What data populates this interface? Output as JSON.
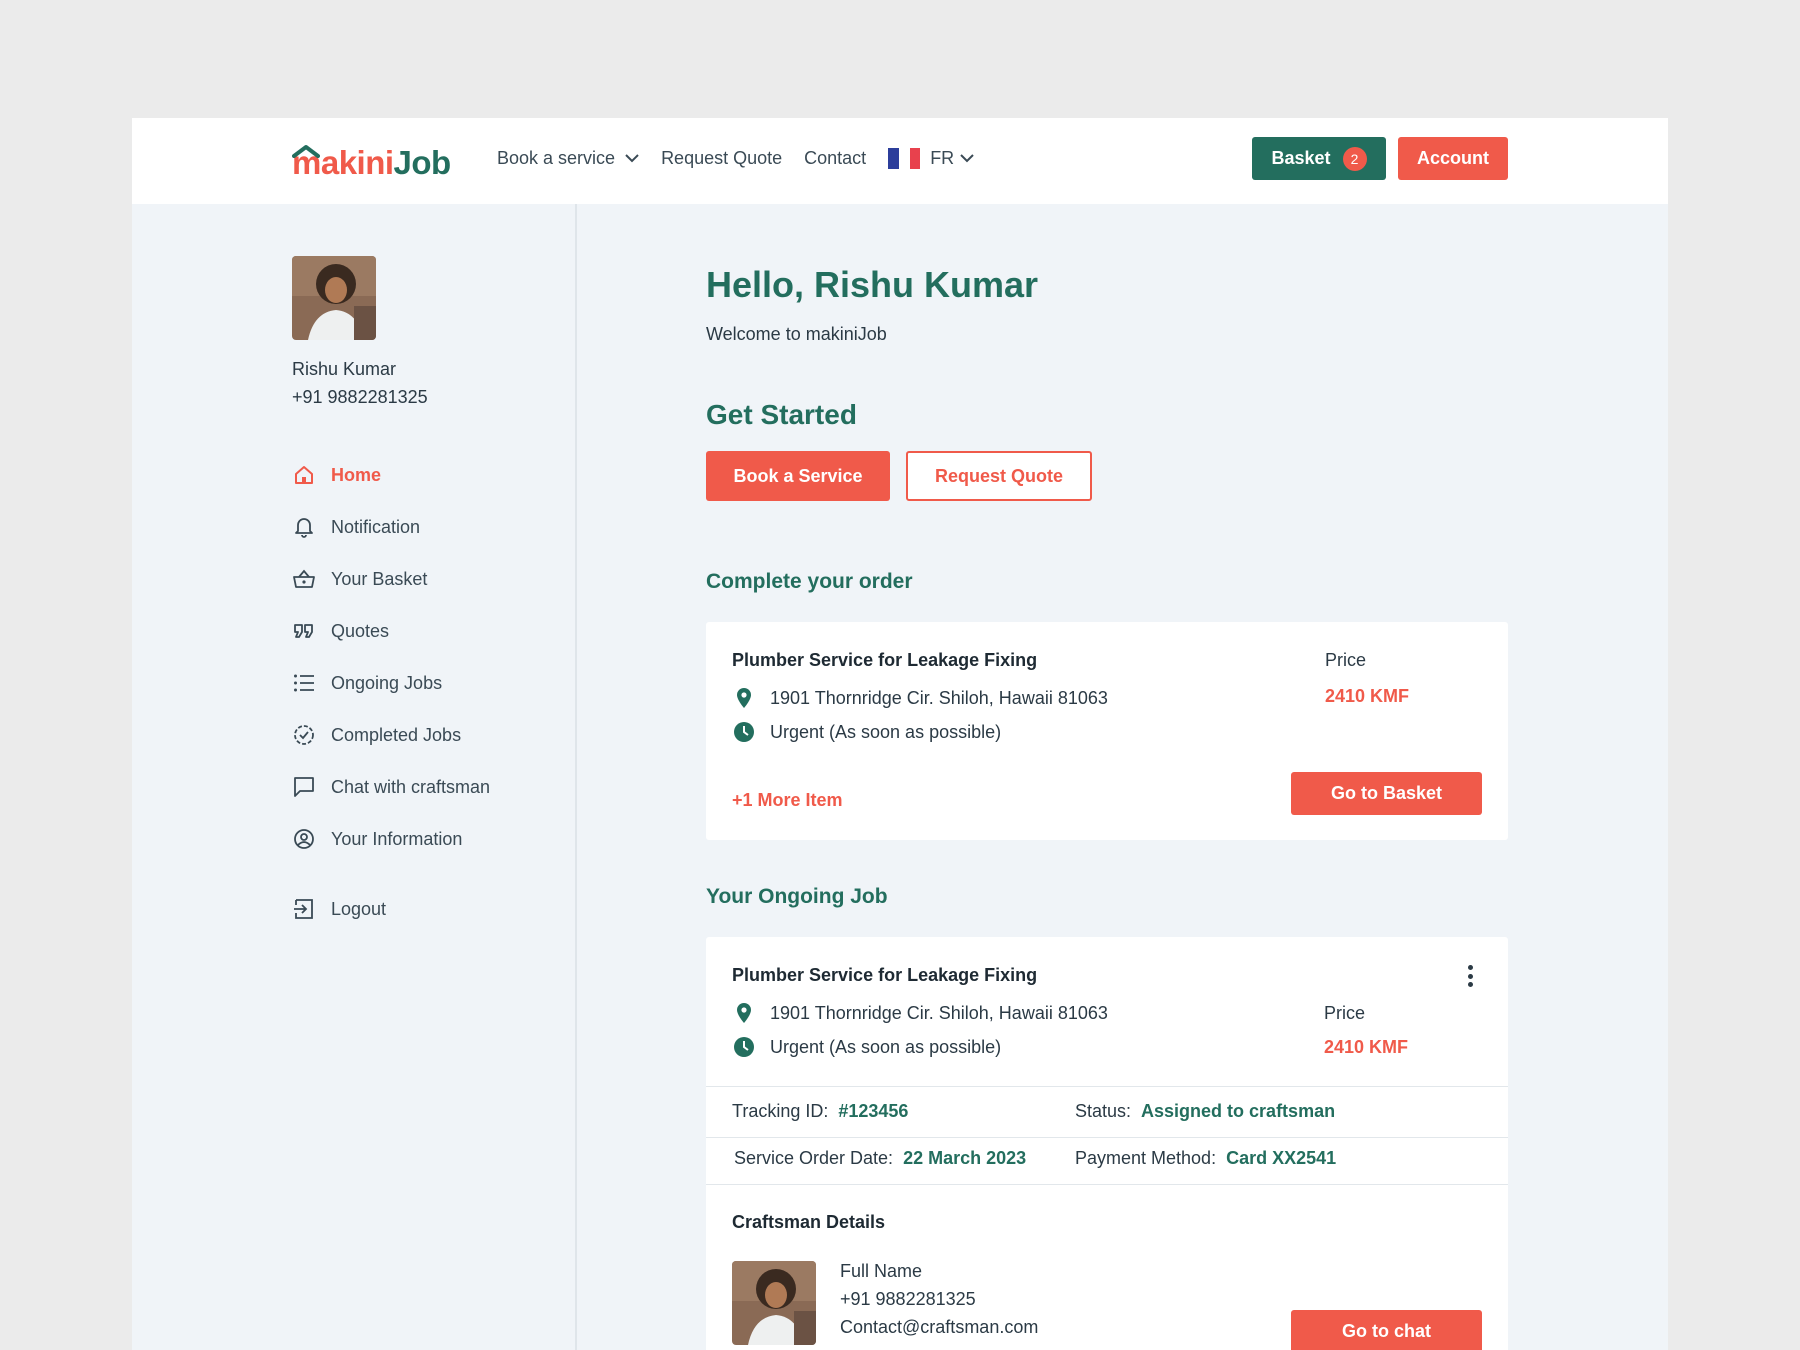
{
  "brand": {
    "logo_part1": "makini",
    "logo_part2": "Job",
    "primary": "#236e5e",
    "accent": "#f05a4a"
  },
  "nav": {
    "book_service": "Book a service",
    "request_quote": "Request Quote",
    "contact": "Contact",
    "language": "FR",
    "basket_label": "Basket",
    "basket_count": "2",
    "account_label": "Account"
  },
  "user": {
    "name": "Rishu Kumar",
    "phone": "+91 9882281325"
  },
  "sidebar": {
    "items": [
      {
        "label": "Home",
        "icon": "home-icon"
      },
      {
        "label": "Notification",
        "icon": "bell-icon"
      },
      {
        "label": "Your Basket",
        "icon": "basket-icon"
      },
      {
        "label": "Quotes",
        "icon": "quote-icon"
      },
      {
        "label": "Ongoing Jobs",
        "icon": "list-icon"
      },
      {
        "label": "Completed Jobs",
        "icon": "check-circle-icon"
      },
      {
        "label": "Chat with craftsman",
        "icon": "chat-icon"
      },
      {
        "label": "Your Information",
        "icon": "user-circle-icon"
      }
    ],
    "logout": "Logout"
  },
  "main": {
    "hello": "Hello, Rishu Kumar",
    "welcome": "Welcome to makiniJob",
    "get_started": "Get Started",
    "book_button": "Book a Service",
    "quote_button": "Request Quote",
    "complete_order_title": "Complete your order",
    "ongoing_title": "Your Ongoing Job"
  },
  "order": {
    "service": "Plumber Service for Leakage Fixing",
    "address": "1901 Thornridge Cir. Shiloh, Hawaii 81063",
    "urgency": "Urgent (As soon as possible)",
    "price_label": "Price",
    "price": "2410 KMF",
    "more": "+1 More Item",
    "button": "Go to Basket"
  },
  "ongoing": {
    "service": "Plumber Service for Leakage Fixing",
    "address": "1901 Thornridge Cir. Shiloh, Hawaii 81063",
    "urgency": "Urgent (As soon as possible)",
    "price_label": "Price",
    "price": "2410 KMF",
    "tracking_label": "Tracking ID:",
    "tracking_value": "#123456",
    "status_label": "Status:",
    "status_value": "Assigned to craftsman",
    "date_label": "Service Order Date:",
    "date_value": "22 March 2023",
    "payment_label": "Payment Method:",
    "payment_value": "Card XX2541",
    "craftsman_title": "Craftsman Details",
    "craftsman_name": "Full Name",
    "craftsman_phone": "+91 9882281325",
    "craftsman_email": "Contact@craftsman.com",
    "chat_button": "Go to chat"
  }
}
